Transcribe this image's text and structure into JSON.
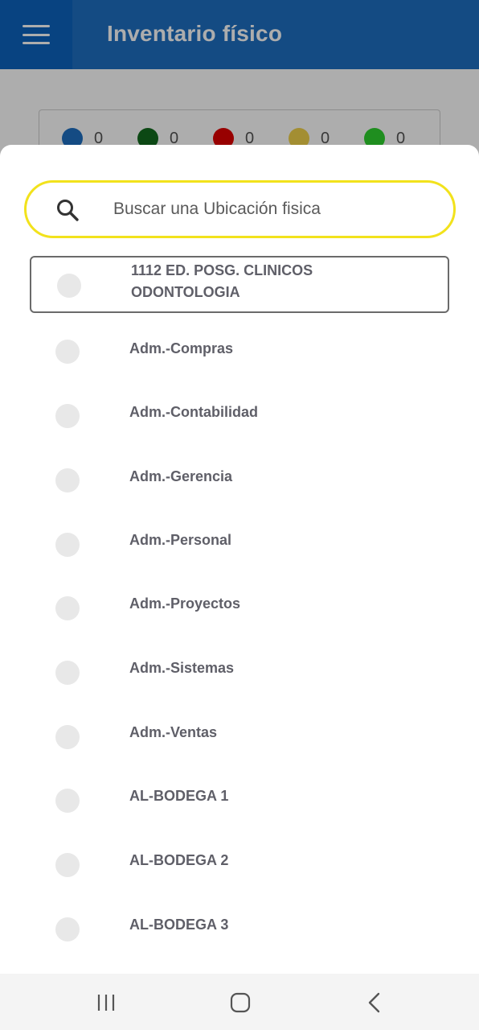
{
  "app": {
    "title": "Inventario físico",
    "status_counts": [
      {
        "color": "#1e6fc2",
        "value": "0"
      },
      {
        "color": "#136b1e",
        "value": "0"
      },
      {
        "color": "#e00000",
        "value": "0"
      },
      {
        "color": "#f0d24a",
        "value": "0"
      },
      {
        "color": "#2fd12f",
        "value": "0"
      }
    ]
  },
  "sheet": {
    "search": {
      "placeholder": "Buscar una Ubicación fisica",
      "value": ""
    },
    "locations": [
      {
        "line1": "1112 ED. POSG. CLINICOS",
        "line2": "ODONTOLOGIA",
        "selected": true
      },
      {
        "line1": "Adm.-Compras",
        "line2": ""
      },
      {
        "line1": "Adm.-Contabilidad",
        "line2": ""
      },
      {
        "line1": "Adm.-Gerencia",
        "line2": ""
      },
      {
        "line1": "Adm.-Personal",
        "line2": ""
      },
      {
        "line1": "Adm.-Proyectos",
        "line2": ""
      },
      {
        "line1": "Adm.-Sistemas",
        "line2": ""
      },
      {
        "line1": "Adm.-Ventas",
        "line2": ""
      },
      {
        "line1": "AL-BODEGA 1",
        "line2": ""
      },
      {
        "line1": "AL-BODEGA 2",
        "line2": ""
      },
      {
        "line1": "AL-BODEGA 3",
        "line2": ""
      }
    ]
  },
  "navbar": {
    "icons": [
      "recent-apps-icon",
      "home-icon",
      "back-icon"
    ]
  }
}
